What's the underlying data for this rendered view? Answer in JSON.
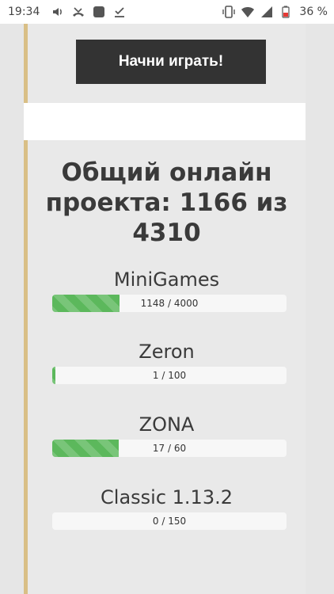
{
  "status_bar": {
    "time": "19:34",
    "battery_pct": "36 %",
    "icons_left": [
      "volume-icon",
      "missed-call-icon",
      "app-icon",
      "download-done-icon"
    ],
    "icons_right": [
      "vibrate-icon",
      "wifi-icon",
      "signal-icon",
      "battery-icon"
    ]
  },
  "play_button": {
    "label": "Начни играть!"
  },
  "online": {
    "heading": "Общий онлайн проекта: 1166 из 4310",
    "servers": [
      {
        "name": "MiniGames",
        "current": 1148,
        "max": 4000,
        "label": "1148 / 4000",
        "fill_fraction": 0.287
      },
      {
        "name": "Zeron",
        "current": 1,
        "max": 100,
        "label": "1 / 100",
        "fill_fraction": 0.01
      },
      {
        "name": "ZONA",
        "current": 17,
        "max": 60,
        "label": "17 / 60",
        "fill_fraction": 0.283
      },
      {
        "name": "Classic 1.13.2",
        "current": 0,
        "max": 150,
        "label": "0 / 150",
        "fill_fraction": 0.0
      }
    ]
  },
  "colors": {
    "accent_border": "#d9bf86",
    "button_bg": "#333333",
    "progress_fill": "#5cb85c"
  }
}
